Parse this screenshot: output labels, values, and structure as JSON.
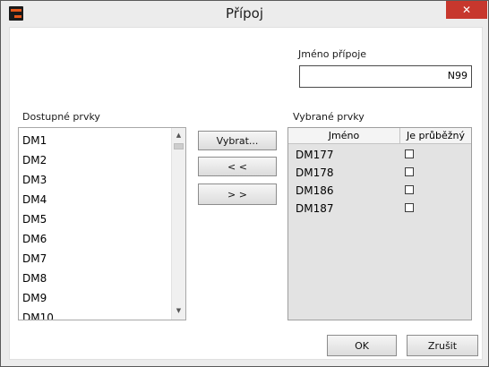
{
  "window": {
    "title": "Přípoj",
    "close_glyph": "✕"
  },
  "connection_name": {
    "label": "Jméno přípoje",
    "value": "N99"
  },
  "available": {
    "label": "Dostupné prvky",
    "items": [
      "DM1",
      "DM2",
      "DM3",
      "DM4",
      "DM5",
      "DM6",
      "DM7",
      "DM8",
      "DM9",
      "DM10"
    ],
    "scroll_up": "▲",
    "scroll_down": "▼"
  },
  "buttons": {
    "select": "Vybrat...",
    "remove": "< <",
    "add": "> >",
    "ok": "OK",
    "cancel": "Zrušit"
  },
  "selected": {
    "label": "Vybrané prvky",
    "columns": [
      "Jméno",
      "Je průběžný"
    ],
    "rows": [
      {
        "name": "DM177",
        "through": false
      },
      {
        "name": "DM178",
        "through": false
      },
      {
        "name": "DM186",
        "through": false
      },
      {
        "name": "DM187",
        "through": false
      }
    ]
  }
}
